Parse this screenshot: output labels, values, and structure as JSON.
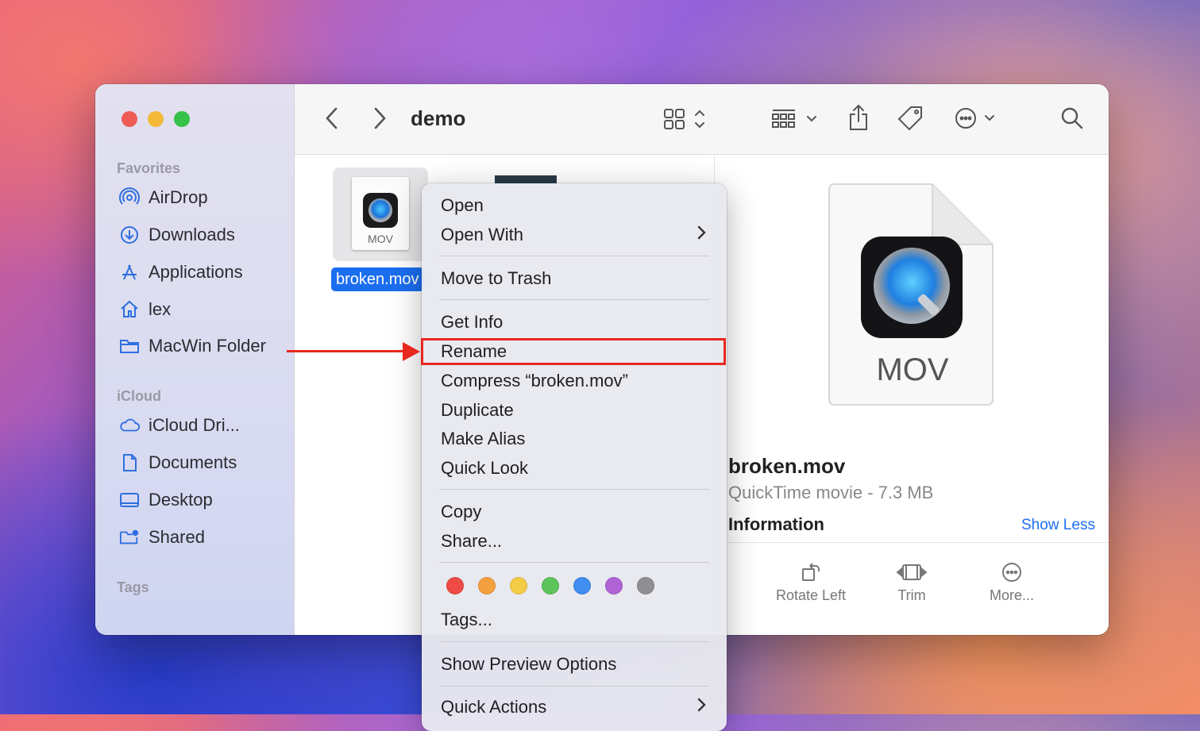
{
  "window": {
    "title": "demo",
    "traffic_lights": {
      "close": "#ee5b55",
      "minimize": "#f5b93a",
      "zoom": "#36c148"
    }
  },
  "sidebar": {
    "favorites_header": "Favorites",
    "favorites": [
      {
        "label": "AirDrop",
        "icon": "airdrop-icon"
      },
      {
        "label": "Downloads",
        "icon": "downloads-icon"
      },
      {
        "label": "Applications",
        "icon": "applications-icon"
      },
      {
        "label": "lex",
        "icon": "home-icon"
      },
      {
        "label": "MacWin Folder",
        "icon": "folder-icon"
      }
    ],
    "icloud_header": "iCloud",
    "icloud": [
      {
        "label": "iCloud Dri...",
        "icon": "icloud-icon"
      },
      {
        "label": "Documents",
        "icon": "document-icon"
      },
      {
        "label": "Desktop",
        "icon": "desktop-icon"
      },
      {
        "label": "Shared",
        "icon": "shared-folder-icon"
      }
    ],
    "tags_header": "Tags"
  },
  "toolbar": {
    "icons": [
      "back-icon",
      "forward-icon",
      "grid-view-icon",
      "group-icon",
      "share-icon",
      "tag-icon",
      "more-actions-icon",
      "search-icon"
    ]
  },
  "file": {
    "name": "broken.mov",
    "icon_label": "MOV"
  },
  "context_menu": {
    "open": "Open",
    "open_with": "Open With",
    "move_to_trash": "Move to Trash",
    "get_info": "Get Info",
    "rename": "Rename",
    "compress": "Compress “broken.mov”",
    "duplicate": "Duplicate",
    "make_alias": "Make Alias",
    "quick_look": "Quick Look",
    "copy": "Copy",
    "share": "Share...",
    "tags": "Tags...",
    "tag_colors": [
      "#ee4b45",
      "#f5a03e",
      "#f5cc45",
      "#5cc45a",
      "#3f8ef0",
      "#b063d4",
      "#8e8e93"
    ],
    "show_preview_options": "Show Preview Options",
    "quick_actions": "Quick Actions"
  },
  "preview": {
    "icon_label": "MOV",
    "file_name": "broken.mov",
    "file_kind": "QuickTime movie - 7.3 MB",
    "information_header": "Information",
    "show_less": "Show Less",
    "quick_actions": [
      {
        "label": "Rotate Left",
        "icon": "rotate-left-icon"
      },
      {
        "label": "Trim",
        "icon": "trim-icon"
      },
      {
        "label": "More...",
        "icon": "more-icon"
      }
    ]
  }
}
